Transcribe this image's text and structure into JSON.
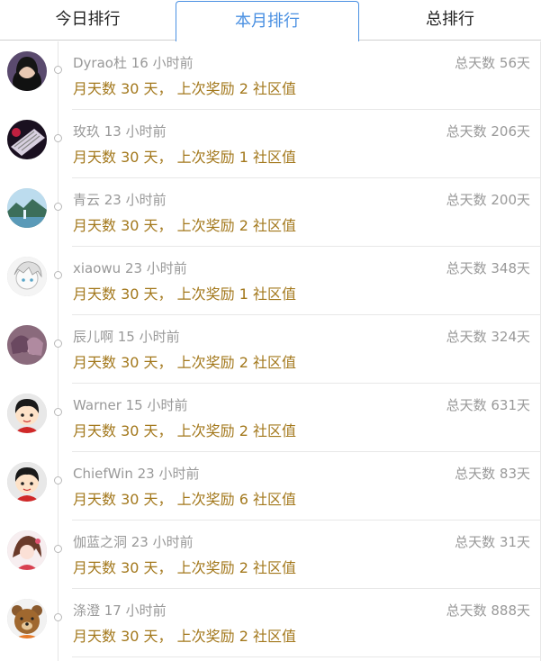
{
  "tabs": [
    {
      "label": "今日排行",
      "active": false
    },
    {
      "label": "本月排行",
      "active": true
    },
    {
      "label": "总排行",
      "active": false
    }
  ],
  "colors": {
    "accent": "#4a90e2",
    "reward_text": "#a3781c",
    "muted_text": "#999999"
  },
  "entries": [
    {
      "name_time": "Dyrao杜 16 小时前",
      "total": "总天数 56天",
      "summary": "月天数 30 天， 上次奖励 2 社区值",
      "avatar": "avatar-girl-dark-hair"
    },
    {
      "name_time": "玫玖 13 小时前",
      "total": "总天数 206天",
      "summary": "月天数 30 天， 上次奖励 1 社区值",
      "avatar": "avatar-keyboard"
    },
    {
      "name_time": "青云 23 小时前",
      "total": "总天数 200天",
      "summary": "月天数 30 天， 上次奖励 2 社区值",
      "avatar": "avatar-landscape"
    },
    {
      "name_time": "xiaowu 23 小时前",
      "total": "总天数 348天",
      "summary": "月天数 30 天， 上次奖励 1 社区值",
      "avatar": "avatar-anime-sketch"
    },
    {
      "name_time": "辰儿啊 15 小时前",
      "total": "总天数 324天",
      "summary": "月天数 30 天， 上次奖励 2 社区值",
      "avatar": "avatar-anime-pink"
    },
    {
      "name_time": "Warner 15 小时前",
      "total": "总天数 631天",
      "summary": "月天数 30 天， 上次奖励 2 社区值",
      "avatar": "avatar-cartoon-boy"
    },
    {
      "name_time": "ChiefWin 23 小时前",
      "total": "总天数 83天",
      "summary": "月天数 30 天， 上次奖励 6 社区值",
      "avatar": "avatar-cartoon-boy"
    },
    {
      "name_time": "伽蓝之洞 23 小时前",
      "total": "总天数 31天",
      "summary": "月天数 30 天， 上次奖励 2 社区值",
      "avatar": "avatar-anime-girl"
    },
    {
      "name_time": "涤澄 17 小时前",
      "total": "总天数 888天",
      "summary": "月天数 30 天， 上次奖励 2 社区值",
      "avatar": "avatar-bear"
    }
  ]
}
